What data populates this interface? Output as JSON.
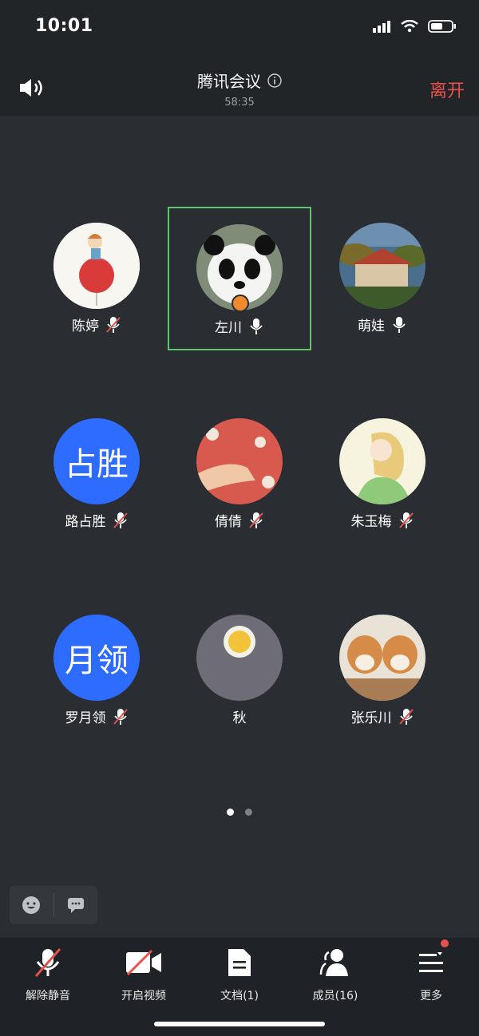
{
  "status_bar": {
    "time": "10:01"
  },
  "header": {
    "title": "腾讯会议",
    "duration": "58:35",
    "leave_label": "离开"
  },
  "participants": [
    {
      "name": "陈婷",
      "mic": "muted",
      "avatar": "photo-balloon-girl"
    },
    {
      "name": "左川",
      "mic": "on",
      "avatar": "photo-panda",
      "active": true,
      "host": true
    },
    {
      "name": "萌娃",
      "mic": "on",
      "avatar": "photo-building"
    },
    {
      "name": "路占胜",
      "mic": "muted",
      "avatar_text": "占胜"
    },
    {
      "name": "倩倩",
      "mic": "muted",
      "avatar": "photo-hand"
    },
    {
      "name": "朱玉梅",
      "mic": "muted",
      "avatar": "photo-illustration-girl"
    },
    {
      "name": "罗月领",
      "mic": "muted",
      "avatar_text": "月领"
    },
    {
      "name": "秋",
      "mic": "none",
      "avatar": "photo-yellow-flower"
    },
    {
      "name": "张乐川",
      "mic": "muted",
      "avatar": "photo-two-dogs"
    }
  ],
  "pager": {
    "pages": 2,
    "current": 1
  },
  "toolbar": {
    "unmute_label": "解除静音",
    "video_label": "开启视频",
    "docs_label": "文档(1)",
    "members_label": "成员(16)",
    "more_label": "更多"
  },
  "colors": {
    "accent_blue": "#2e6bff",
    "leave_red": "#e5514c",
    "active_border": "#5fc46b",
    "host_orange": "#ef8a2d"
  }
}
